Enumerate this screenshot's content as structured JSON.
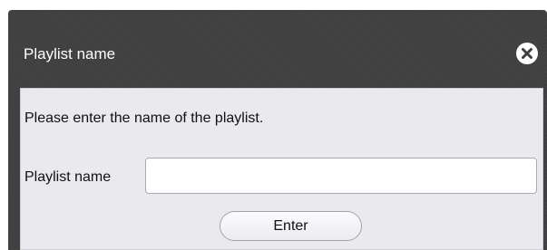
{
  "dialog": {
    "title": "Playlist name",
    "close_icon": "close-circle-x-icon",
    "message": "Please enter the name of the playlist.",
    "field": {
      "label": "Playlist name",
      "value": "",
      "placeholder": ""
    },
    "enter_label": "Enter"
  },
  "colors": {
    "titlebar_bg": "#3f3f3f",
    "content_bg": "#e9e9ee",
    "title_text": "#ffffff"
  }
}
